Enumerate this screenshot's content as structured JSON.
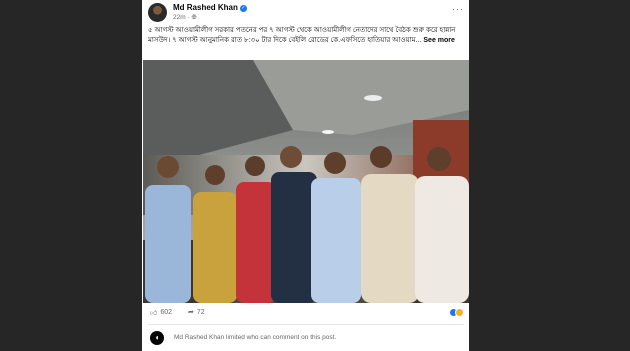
{
  "post": {
    "author": "Md Rashed Khan",
    "time": "22m",
    "privacy_icon": "globe-icon",
    "caption": "৫ আগস্ট আওয়ামীলীগ সরকার পতনের পর ৭ আগস্ট থেকে আওয়ামীলীগ নেতাদের সাথে বৈঠক শুরু করে হান্নান মাসউদ। ৭ আগস্ট আনুমানিক রাত ৮:৩০ টার দিকে বেইলি রোডের কে.এফসিতে হাতিয়ার আওয়াম...",
    "see_more": "See more",
    "like_count": "602",
    "share_count": "72",
    "comment_notice": "Md Rashed Khan limited who can comment on this post.",
    "colors": {
      "brand_blue": "#1877f2",
      "text_primary": "#050505",
      "text_secondary": "#65676b",
      "divider": "#e4e6eb"
    }
  }
}
